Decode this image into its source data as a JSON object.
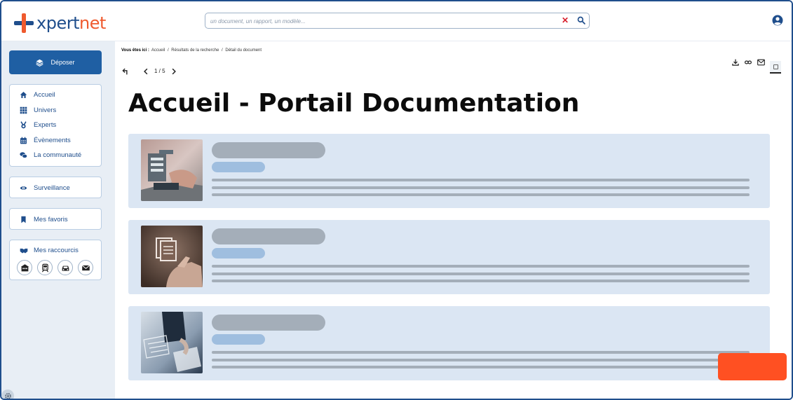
{
  "brand": {
    "name_part1": "xpert",
    "name_part2": "net",
    "mark_color": "#ef5a2e",
    "mark_color_2": "#1f4e8c"
  },
  "search": {
    "placeholder": "un document, un rapport, un modèle...",
    "value": "",
    "clear_icon": "close-icon",
    "submit_icon": "search-icon"
  },
  "header": {
    "user_icon": "user-circle-icon"
  },
  "sidebar": {
    "deposit_label": "Déposer",
    "nav": [
      {
        "label": "Accueil",
        "icon": "home-icon"
      },
      {
        "label": "Univers",
        "icon": "grid-icon"
      },
      {
        "label": "Experts",
        "icon": "medal-icon"
      },
      {
        "label": "Évènements",
        "icon": "calendar-icon"
      },
      {
        "label": "La communauté",
        "icon": "chat-icon"
      }
    ],
    "surveillance_label": "Surveillance",
    "favorites_label": "Mes favoris",
    "shortcuts_title": "Mes raccourcis",
    "shortcuts": [
      "building-icon",
      "train-icon",
      "car-icon",
      "mail-icon"
    ],
    "accent_color": "#1f4e8c",
    "deposit_color": "#1f5fa3"
  },
  "breadcrumb": {
    "prefix": "Vous êtes ici :",
    "items": [
      "Accueil",
      "Résultats de la recherche",
      "Détail du document"
    ],
    "separator": "/"
  },
  "pager": {
    "current": "1",
    "total": "5",
    "text": "1 / 5"
  },
  "page_title": "Accueil - Portail Documentation",
  "results": [
    {
      "thumb": "laptop-documents-photo"
    },
    {
      "thumb": "document-hand-photo"
    },
    {
      "thumb": "office-papers-photo"
    }
  ],
  "colors": {
    "card_bg": "#dbe6f3",
    "placeholder_gray": "#a4aeb9",
    "placeholder_blue": "#9fbedf",
    "fab": "#ff5022"
  }
}
